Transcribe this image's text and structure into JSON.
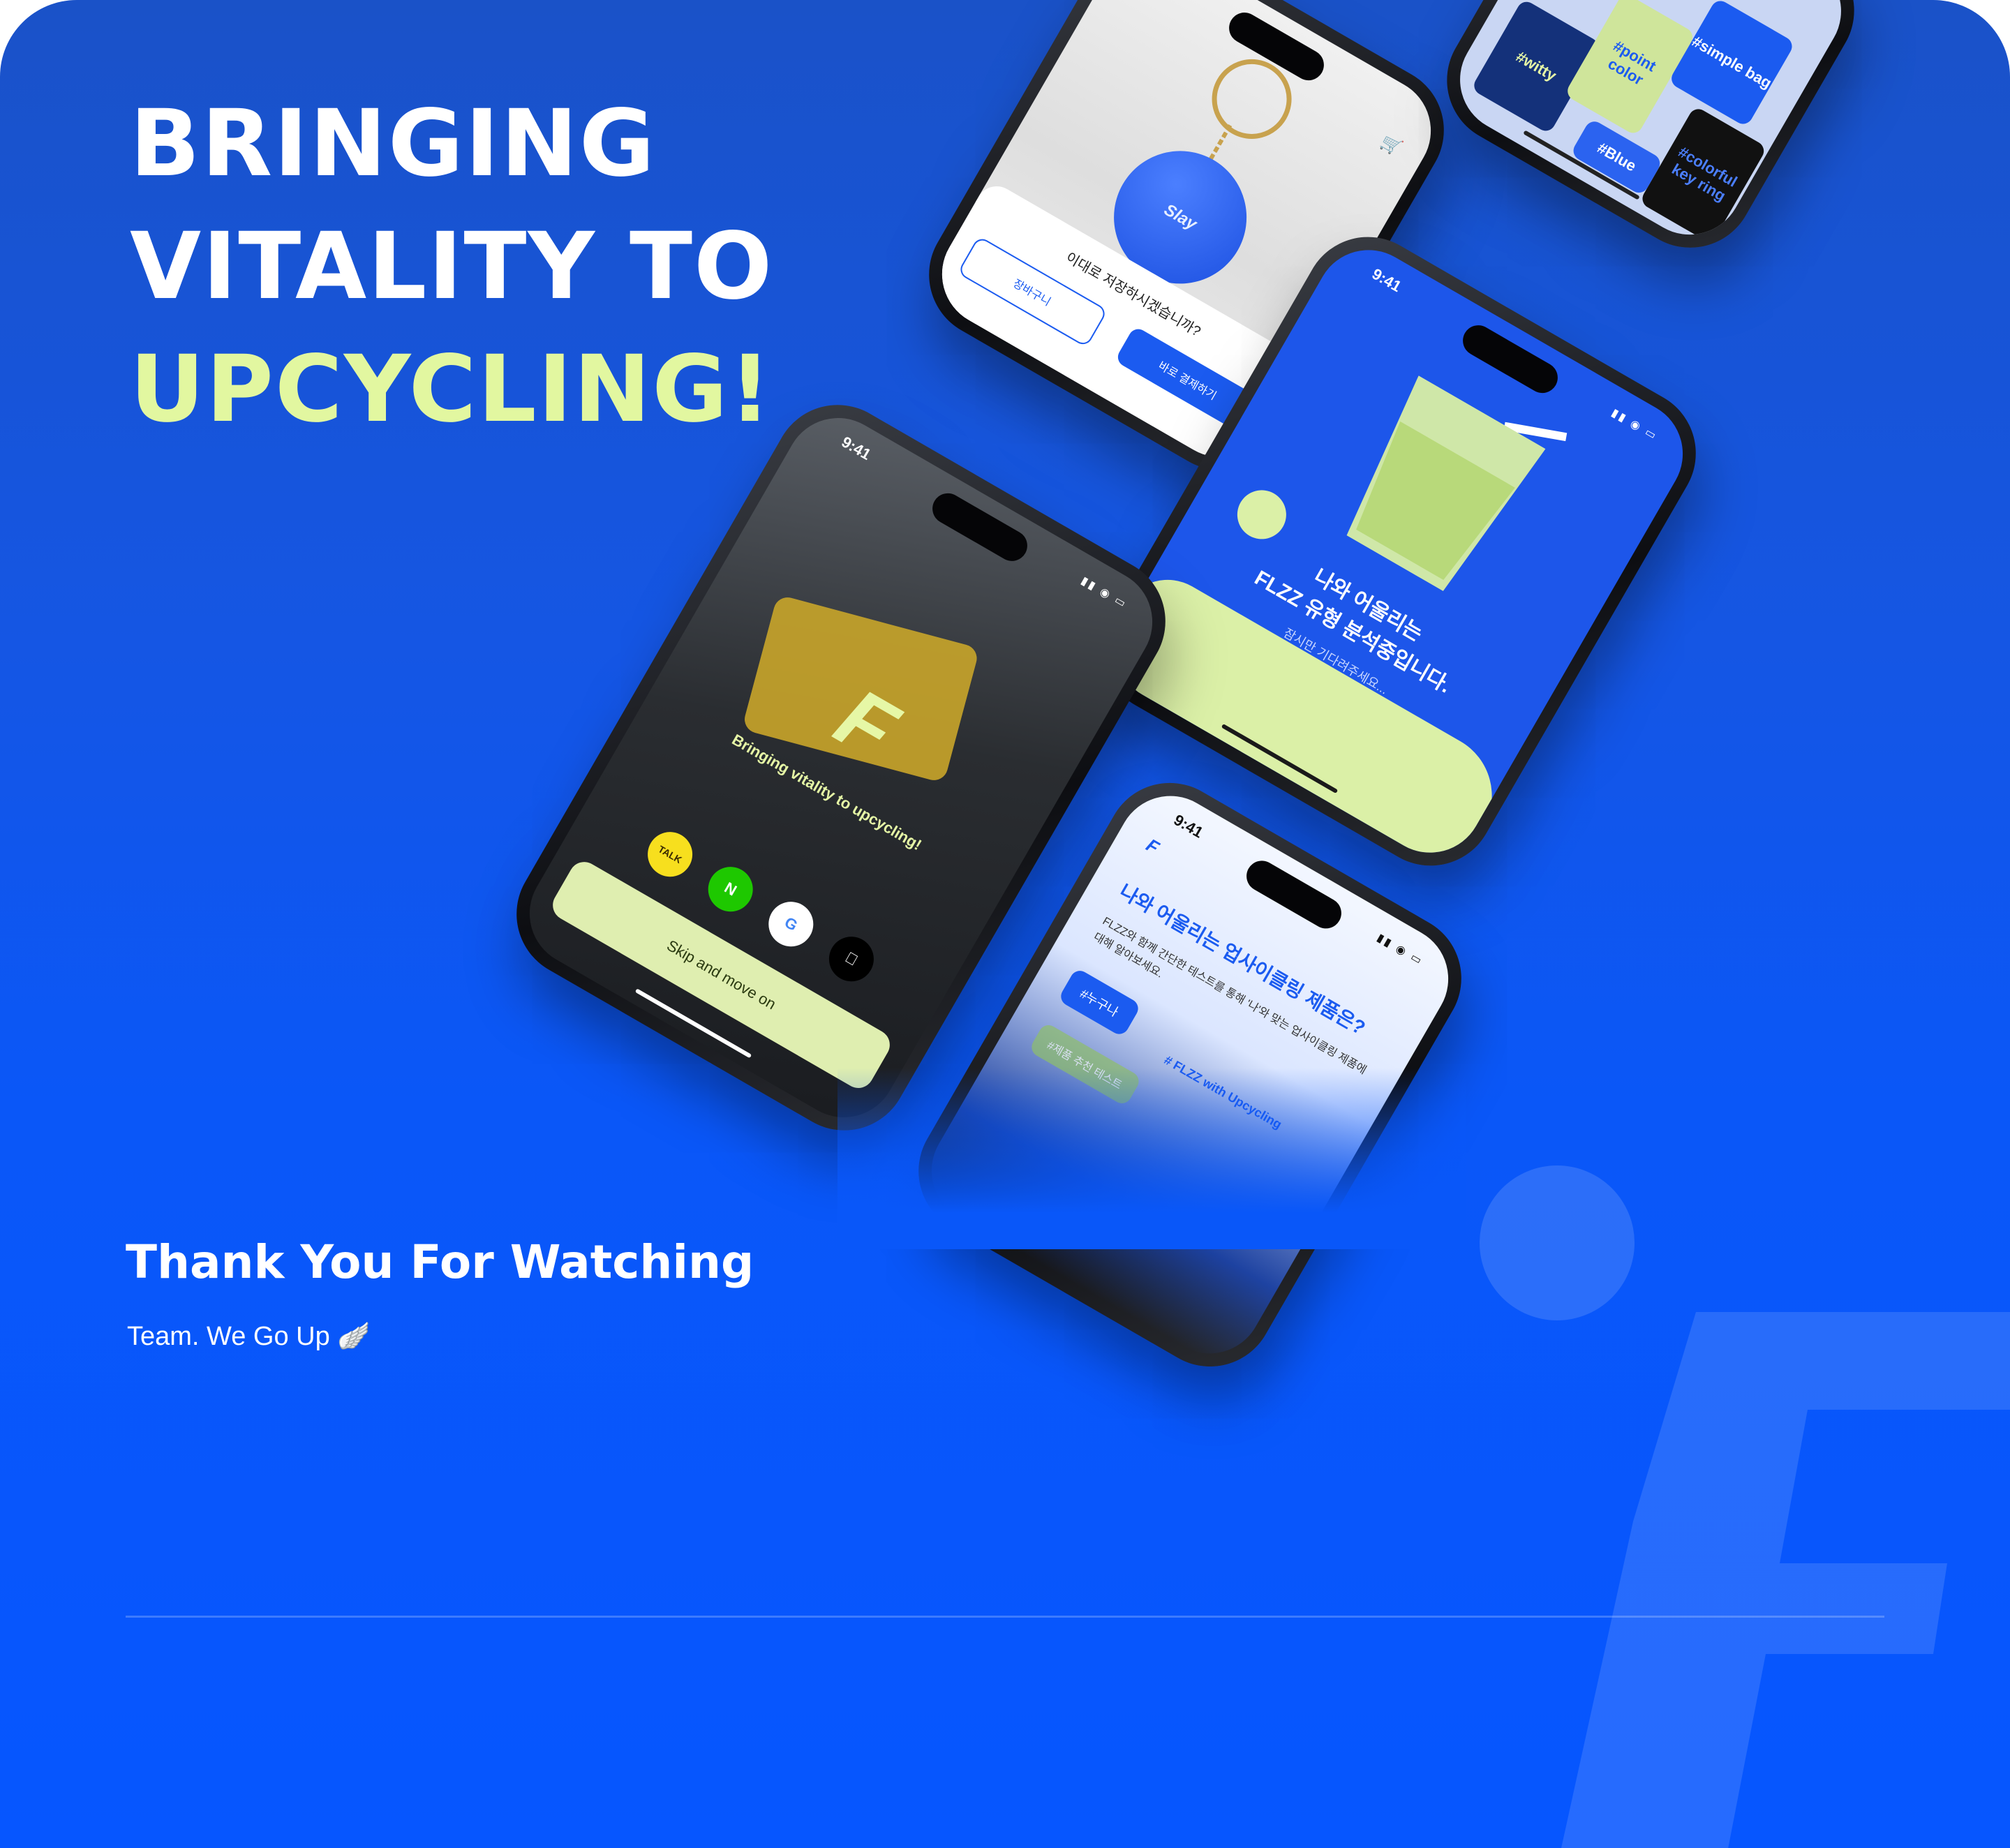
{
  "headline": {
    "line1": "BRINGING",
    "line2": "VITALITY TO",
    "line3": "UPCYCLING!"
  },
  "footer": {
    "thanks": "Thank You For Watching",
    "team": "Team. We Go Up 🪽"
  },
  "colors": {
    "background": "#0656ff",
    "accent": "#e2f7a0",
    "white": "#ffffff"
  },
  "phones": {
    "keyring": {
      "tag_text": "Slay",
      "question": "이대로 저장하시겠습니까?",
      "btn_cart": "장바구니",
      "btn_pay": "바로 결제하기",
      "cart_icon": "cart-icon"
    },
    "tags": {
      "items": [
        "#witty",
        "#point color",
        "#simple bag",
        "#colorful key ring",
        "#Blue"
      ]
    },
    "analyzing": {
      "time": "9:41",
      "title_line1": "나와 어울리는",
      "title_line2": "FLZZ 유형 분석중입니다.",
      "subtitle": "잠시만 기다려주세요..."
    },
    "login": {
      "time": "9:41",
      "logo": "F",
      "tagline": "Bringing vitality to upcycling!",
      "social": [
        "TALK",
        "N",
        "G",
        ""
      ],
      "skip": "Skip and move on"
    },
    "survey": {
      "time": "9:41",
      "logo": "F",
      "title": "나와 어울리는 업사이클링 제품은?",
      "desc": "FLZZ와 함께 간단한 테스트를 통해 '나'와 맞는 업사이클링 제품에 대해 알아보세요.",
      "chip": "#누구나",
      "hashtag": "# FLZZ with Upcycling",
      "chip2": "#제품 추천 테스트"
    }
  }
}
